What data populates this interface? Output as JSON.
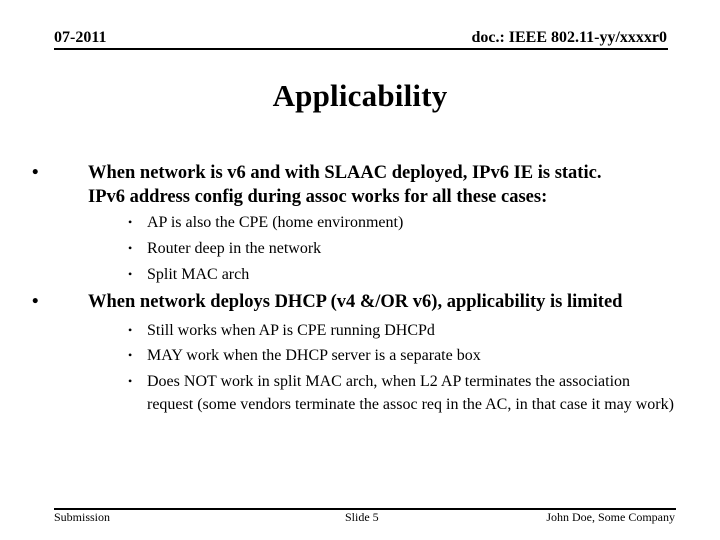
{
  "header": {
    "date": "07-2011",
    "doc_id": "doc.: IEEE 802.11-yy/xxxxr0"
  },
  "title": "Applicability",
  "bullets": [
    {
      "marker": "•",
      "lines": [
        "When network is v6 and with SLAAC deployed, IPv6 IE is static.",
        "IPv6 address config during assoc works for all these cases:"
      ],
      "sub_bullets": [
        {
          "marker": "•",
          "text": "AP is also the CPE (home environment)"
        },
        {
          "marker": "•",
          "text": "Router deep in the network"
        },
        {
          "marker": "•",
          "text": "Split MAC arch"
        }
      ]
    },
    {
      "marker": "•",
      "lines": [
        "When network deploys DHCP (v4 &/OR v6), applicability is limited"
      ],
      "sub_bullets": [
        {
          "marker": "•",
          "text": "Still works when AP is CPE running DHCPd"
        },
        {
          "marker": "•",
          "text": "MAY work when the DHCP server is a separate box"
        },
        {
          "marker": "•",
          "text": "Does NOT work in split MAC arch, when L2 AP terminates the association request (some vendors terminate the assoc req in the AC, in that case it may work)"
        }
      ]
    }
  ],
  "footer": {
    "left": "Submission",
    "center": "Slide 5",
    "right": "John Doe, Some Company"
  }
}
